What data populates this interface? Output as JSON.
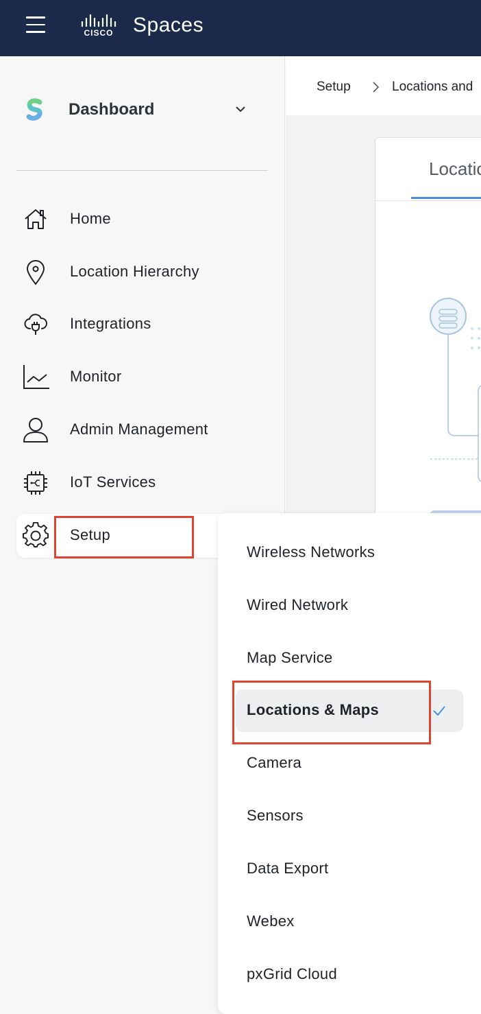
{
  "header": {
    "menu_icon": "hamburger-icon",
    "brand_logo": "cisco-logo",
    "brand_logo_text": "CISCO",
    "brand_name": "Spaces",
    "bg_color": "#1b2a4a"
  },
  "sidebar": {
    "dashboard": {
      "label": "Dashboard",
      "icon": "spaces-logo-icon",
      "chevron": "chevron-down-icon"
    },
    "items": [
      {
        "label": "Home",
        "icon": "home-icon"
      },
      {
        "label": "Location Hierarchy",
        "icon": "location-pin-icon"
      },
      {
        "label": "Integrations",
        "icon": "cloud-plug-icon"
      },
      {
        "label": "Monitor",
        "icon": "line-chart-icon"
      },
      {
        "label": "Admin Management",
        "icon": "user-icon"
      },
      {
        "label": "IoT Services",
        "icon": "chip-icon"
      },
      {
        "label": "Setup",
        "icon": "gear-icon",
        "active": true
      }
    ]
  },
  "breadcrumb": {
    "items": [
      "Setup",
      "Locations and"
    ],
    "separator_icon": "chevron-right-icon"
  },
  "card": {
    "tab_label": "Locatic"
  },
  "setup_menu": {
    "items": [
      {
        "label": "Wireless Networks"
      },
      {
        "label": "Wired Network"
      },
      {
        "label": "Map Service"
      },
      {
        "label": "Locations & Maps",
        "selected": true
      },
      {
        "label": "Camera"
      },
      {
        "label": "Sensors"
      },
      {
        "label": "Data Export"
      },
      {
        "label": "Webex"
      },
      {
        "label": "pxGrid Cloud"
      }
    ],
    "check_icon": "checkmark-icon"
  },
  "colors": {
    "highlight": "#e0442e",
    "accent": "#4a90d9",
    "selected_bg": "#eceef0"
  }
}
